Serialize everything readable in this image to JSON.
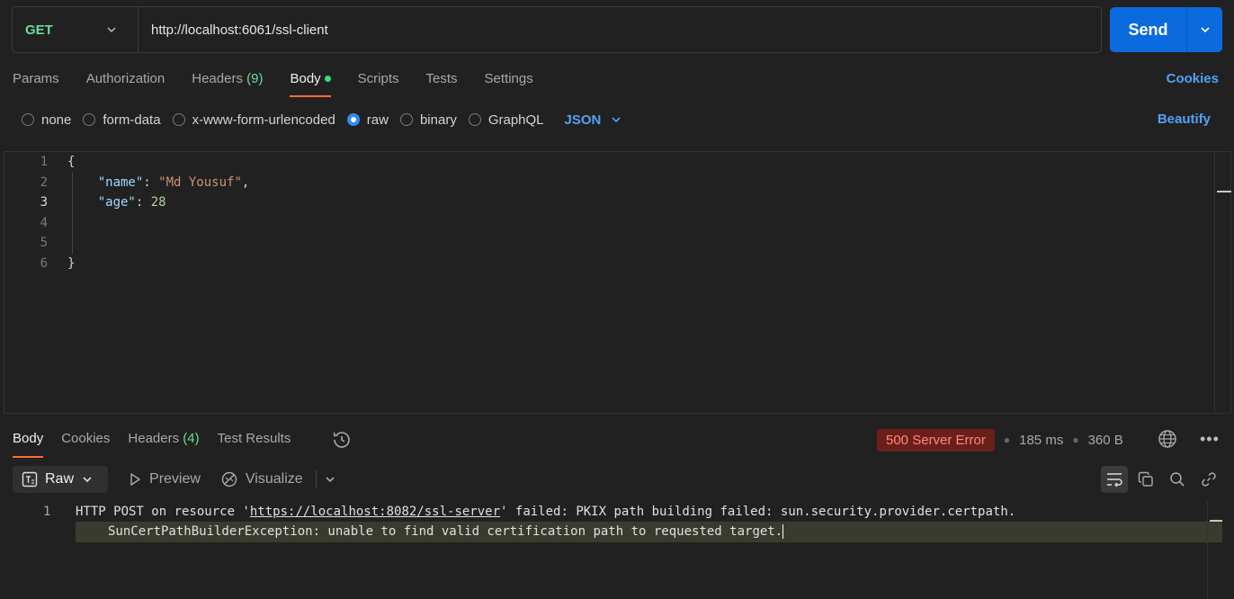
{
  "request": {
    "method": "GET",
    "url": "http://localhost:6061/ssl-client",
    "send_label": "Send"
  },
  "req_tabs": [
    {
      "label": "Params"
    },
    {
      "label": "Authorization"
    },
    {
      "label": "Headers",
      "count": "(9)"
    },
    {
      "label": "Body",
      "active": true
    },
    {
      "label": "Scripts"
    },
    {
      "label": "Tests"
    },
    {
      "label": "Settings"
    }
  ],
  "cookies_label": "Cookies",
  "body_types": [
    "none",
    "form-data",
    "x-www-form-urlencoded",
    "raw",
    "binary",
    "GraphQL"
  ],
  "body_type_selected": "raw",
  "format": "JSON",
  "beautify_label": "Beautify",
  "editor": {
    "line_numbers": [
      "1",
      "2",
      "3",
      "4",
      "5",
      "6"
    ],
    "current_line": "3",
    "open_brace": "{",
    "close_brace": "}",
    "name_key": "\"name\"",
    "name_value": "\"Md Yousuf\"",
    "age_key": "\"age\"",
    "age_value": "28"
  },
  "response": {
    "tabs": [
      {
        "label": "Body",
        "active": true
      },
      {
        "label": "Cookies"
      },
      {
        "label": "Headers",
        "count": "(4)"
      },
      {
        "label": "Test Results"
      }
    ],
    "status": "500 Server Error",
    "time": "185 ms",
    "size": "360 B",
    "view_mode": "Raw",
    "preview_label": "Preview",
    "visualize_label": "Visualize",
    "line_number": "1",
    "text_pre": "HTTP POST on resource '",
    "text_link": "https://localhost:8082/ssl-server",
    "text_post": "' failed: PKIX path building failed: sun.security.provider.certpath.",
    "text_line2": "SunCertPathBuilderException: unable to find valid certification path to requested target."
  },
  "colors": {
    "accent_blue": "#0b6bde",
    "active_tab_underline": "#ff6c37",
    "method_green": "#6bdd9a",
    "error_badge": "#6b1f1a"
  }
}
